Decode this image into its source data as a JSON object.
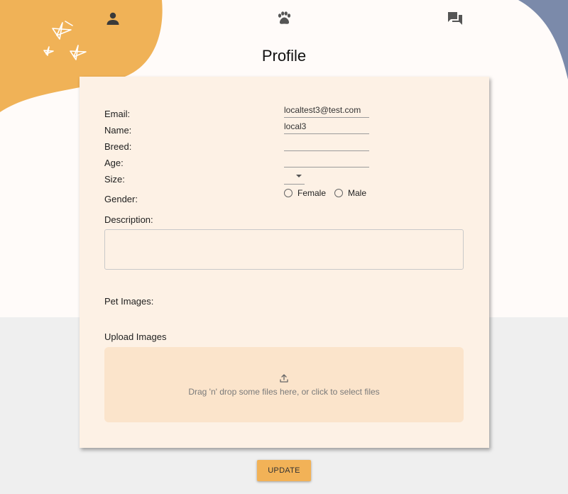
{
  "nav": {
    "profile_icon": "person-icon",
    "pet_icon": "paw-icon",
    "chat_icon": "chat-icon"
  },
  "page": {
    "title": "Profile"
  },
  "form": {
    "labels": {
      "email": "Email:",
      "name": "Name:",
      "breed": "Breed:",
      "age": "Age:",
      "size": "Size:",
      "gender": "Gender:",
      "description": "Description:",
      "pet_images": "Pet Images:",
      "upload_images": "Upload Images"
    },
    "values": {
      "email": "localtest3@test.com",
      "name": "local3",
      "breed": "",
      "age": "",
      "size": "",
      "description": ""
    },
    "gender_options": [
      "Female",
      "Male"
    ],
    "dropzone_text": "Drag 'n' drop some files here, or click to select files",
    "update_label": "UPDATE"
  },
  "colors": {
    "accent": "#f2b257",
    "card": "#fdf1e5",
    "dropzone": "#fbe4cb",
    "corner_blob": "#7b8aaa"
  }
}
